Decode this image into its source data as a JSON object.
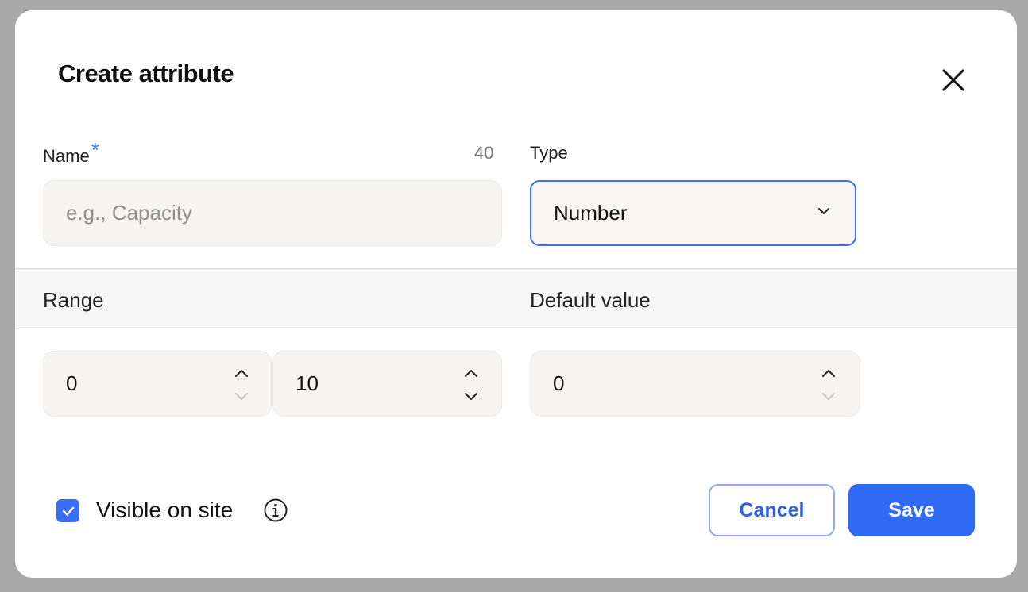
{
  "dialog": {
    "title": "Create attribute",
    "close_icon": "close-icon"
  },
  "name_field": {
    "label": "Name",
    "required_mark": "*",
    "char_count": "40",
    "placeholder": "e.g., Capacity",
    "value": ""
  },
  "type_field": {
    "label": "Type",
    "value": "Number",
    "icon": "chevron-down-icon"
  },
  "section": {
    "range_label": "Range",
    "default_label": "Default value"
  },
  "range": {
    "min": "0",
    "max": "10"
  },
  "default_value": "0",
  "footer": {
    "visible_label": "Visible on site",
    "visible_checked": true,
    "info_icon": "info-icon",
    "cancel_label": "Cancel",
    "save_label": "Save"
  },
  "colors": {
    "accent": "#3b6ef6",
    "save_bg": "#2f6bf5",
    "cancel_text": "#2f5fe8"
  }
}
